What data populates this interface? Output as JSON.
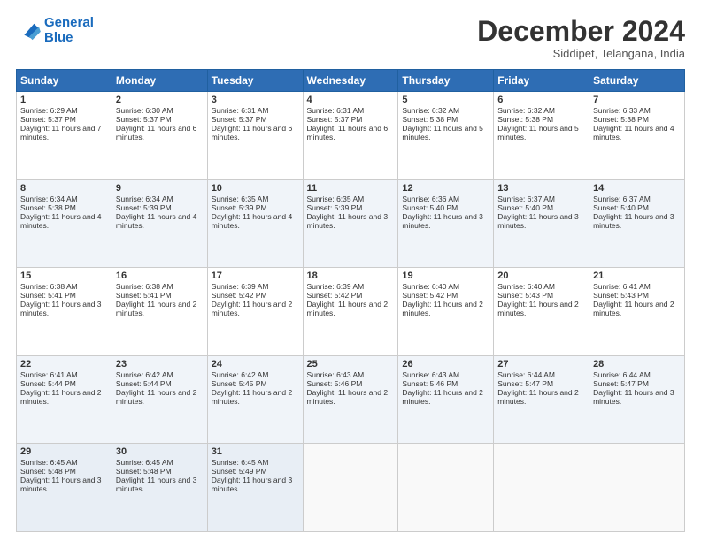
{
  "logo": {
    "line1": "General",
    "line2": "Blue"
  },
  "title": "December 2024",
  "location": "Siddipet, Telangana, India",
  "headers": [
    "Sunday",
    "Monday",
    "Tuesday",
    "Wednesday",
    "Thursday",
    "Friday",
    "Saturday"
  ],
  "weeks": [
    [
      {
        "day": "1",
        "sunrise": "Sunrise: 6:29 AM",
        "sunset": "Sunset: 5:37 PM",
        "daylight": "Daylight: 11 hours and 7 minutes."
      },
      {
        "day": "2",
        "sunrise": "Sunrise: 6:30 AM",
        "sunset": "Sunset: 5:37 PM",
        "daylight": "Daylight: 11 hours and 6 minutes."
      },
      {
        "day": "3",
        "sunrise": "Sunrise: 6:31 AM",
        "sunset": "Sunset: 5:37 PM",
        "daylight": "Daylight: 11 hours and 6 minutes."
      },
      {
        "day": "4",
        "sunrise": "Sunrise: 6:31 AM",
        "sunset": "Sunset: 5:37 PM",
        "daylight": "Daylight: 11 hours and 6 minutes."
      },
      {
        "day": "5",
        "sunrise": "Sunrise: 6:32 AM",
        "sunset": "Sunset: 5:38 PM",
        "daylight": "Daylight: 11 hours and 5 minutes."
      },
      {
        "day": "6",
        "sunrise": "Sunrise: 6:32 AM",
        "sunset": "Sunset: 5:38 PM",
        "daylight": "Daylight: 11 hours and 5 minutes."
      },
      {
        "day": "7",
        "sunrise": "Sunrise: 6:33 AM",
        "sunset": "Sunset: 5:38 PM",
        "daylight": "Daylight: 11 hours and 4 minutes."
      }
    ],
    [
      {
        "day": "8",
        "sunrise": "Sunrise: 6:34 AM",
        "sunset": "Sunset: 5:38 PM",
        "daylight": "Daylight: 11 hours and 4 minutes."
      },
      {
        "day": "9",
        "sunrise": "Sunrise: 6:34 AM",
        "sunset": "Sunset: 5:39 PM",
        "daylight": "Daylight: 11 hours and 4 minutes."
      },
      {
        "day": "10",
        "sunrise": "Sunrise: 6:35 AM",
        "sunset": "Sunset: 5:39 PM",
        "daylight": "Daylight: 11 hours and 4 minutes."
      },
      {
        "day": "11",
        "sunrise": "Sunrise: 6:35 AM",
        "sunset": "Sunset: 5:39 PM",
        "daylight": "Daylight: 11 hours and 3 minutes."
      },
      {
        "day": "12",
        "sunrise": "Sunrise: 6:36 AM",
        "sunset": "Sunset: 5:40 PM",
        "daylight": "Daylight: 11 hours and 3 minutes."
      },
      {
        "day": "13",
        "sunrise": "Sunrise: 6:37 AM",
        "sunset": "Sunset: 5:40 PM",
        "daylight": "Daylight: 11 hours and 3 minutes."
      },
      {
        "day": "14",
        "sunrise": "Sunrise: 6:37 AM",
        "sunset": "Sunset: 5:40 PM",
        "daylight": "Daylight: 11 hours and 3 minutes."
      }
    ],
    [
      {
        "day": "15",
        "sunrise": "Sunrise: 6:38 AM",
        "sunset": "Sunset: 5:41 PM",
        "daylight": "Daylight: 11 hours and 3 minutes."
      },
      {
        "day": "16",
        "sunrise": "Sunrise: 6:38 AM",
        "sunset": "Sunset: 5:41 PM",
        "daylight": "Daylight: 11 hours and 2 minutes."
      },
      {
        "day": "17",
        "sunrise": "Sunrise: 6:39 AM",
        "sunset": "Sunset: 5:42 PM",
        "daylight": "Daylight: 11 hours and 2 minutes."
      },
      {
        "day": "18",
        "sunrise": "Sunrise: 6:39 AM",
        "sunset": "Sunset: 5:42 PM",
        "daylight": "Daylight: 11 hours and 2 minutes."
      },
      {
        "day": "19",
        "sunrise": "Sunrise: 6:40 AM",
        "sunset": "Sunset: 5:42 PM",
        "daylight": "Daylight: 11 hours and 2 minutes."
      },
      {
        "day": "20",
        "sunrise": "Sunrise: 6:40 AM",
        "sunset": "Sunset: 5:43 PM",
        "daylight": "Daylight: 11 hours and 2 minutes."
      },
      {
        "day": "21",
        "sunrise": "Sunrise: 6:41 AM",
        "sunset": "Sunset: 5:43 PM",
        "daylight": "Daylight: 11 hours and 2 minutes."
      }
    ],
    [
      {
        "day": "22",
        "sunrise": "Sunrise: 6:41 AM",
        "sunset": "Sunset: 5:44 PM",
        "daylight": "Daylight: 11 hours and 2 minutes."
      },
      {
        "day": "23",
        "sunrise": "Sunrise: 6:42 AM",
        "sunset": "Sunset: 5:44 PM",
        "daylight": "Daylight: 11 hours and 2 minutes."
      },
      {
        "day": "24",
        "sunrise": "Sunrise: 6:42 AM",
        "sunset": "Sunset: 5:45 PM",
        "daylight": "Daylight: 11 hours and 2 minutes."
      },
      {
        "day": "25",
        "sunrise": "Sunrise: 6:43 AM",
        "sunset": "Sunset: 5:46 PM",
        "daylight": "Daylight: 11 hours and 2 minutes."
      },
      {
        "day": "26",
        "sunrise": "Sunrise: 6:43 AM",
        "sunset": "Sunset: 5:46 PM",
        "daylight": "Daylight: 11 hours and 2 minutes."
      },
      {
        "day": "27",
        "sunrise": "Sunrise: 6:44 AM",
        "sunset": "Sunset: 5:47 PM",
        "daylight": "Daylight: 11 hours and 2 minutes."
      },
      {
        "day": "28",
        "sunrise": "Sunrise: 6:44 AM",
        "sunset": "Sunset: 5:47 PM",
        "daylight": "Daylight: 11 hours and 3 minutes."
      }
    ],
    [
      {
        "day": "29",
        "sunrise": "Sunrise: 6:45 AM",
        "sunset": "Sunset: 5:48 PM",
        "daylight": "Daylight: 11 hours and 3 minutes."
      },
      {
        "day": "30",
        "sunrise": "Sunrise: 6:45 AM",
        "sunset": "Sunset: 5:48 PM",
        "daylight": "Daylight: 11 hours and 3 minutes."
      },
      {
        "day": "31",
        "sunrise": "Sunrise: 6:45 AM",
        "sunset": "Sunset: 5:49 PM",
        "daylight": "Daylight: 11 hours and 3 minutes."
      },
      null,
      null,
      null,
      null
    ]
  ]
}
